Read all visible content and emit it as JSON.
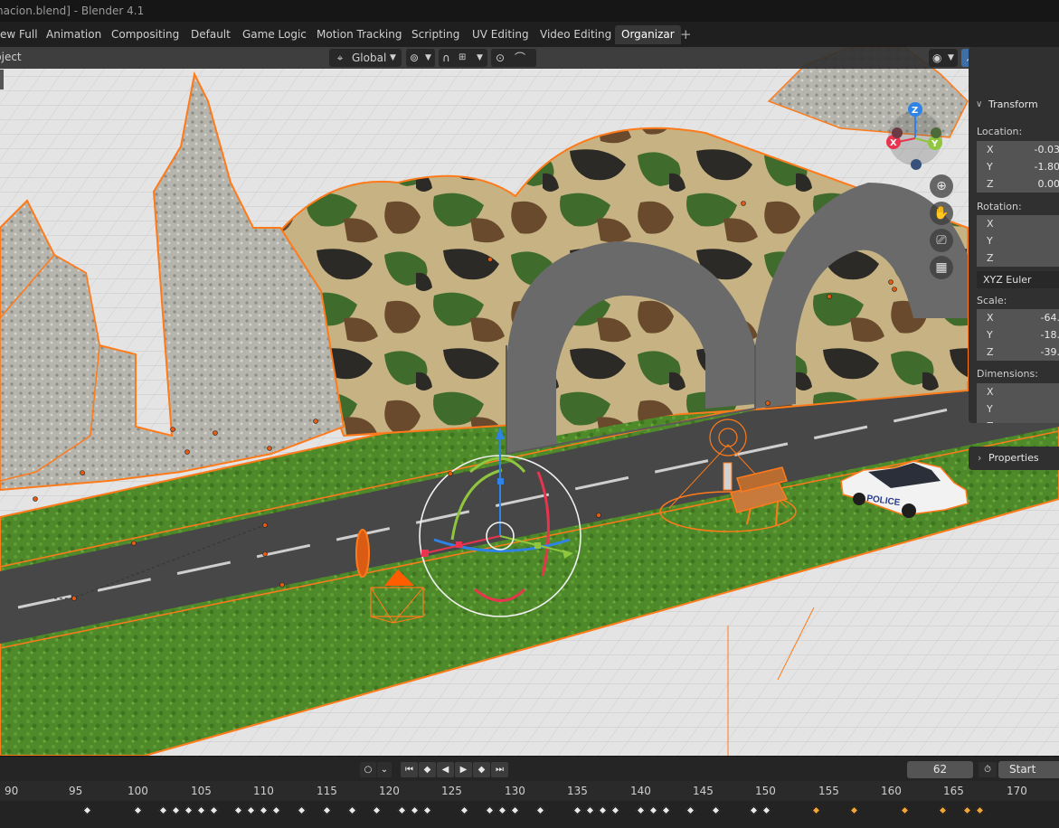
{
  "titlebar": {
    "title": "nacion.blend] - Blender 4.1"
  },
  "workspace_tabs": [
    {
      "label": "ew Full"
    },
    {
      "label": "Animation"
    },
    {
      "label": "Compositing"
    },
    {
      "label": "Default"
    },
    {
      "label": "Game Logic"
    },
    {
      "label": "Motion Tracking"
    },
    {
      "label": "Scripting"
    },
    {
      "label": "UV Editing"
    },
    {
      "label": "Video Editing"
    },
    {
      "label": "Organizar",
      "active": true
    }
  ],
  "tab_add": "+",
  "viewport_header": {
    "mode": "bject",
    "orientation": "Global"
  },
  "gizmo": {
    "x": "X",
    "y": "Y",
    "z": "Z"
  },
  "transform_panel": {
    "title": "Transform",
    "location_label": "Location:",
    "location": [
      {
        "axis": "X",
        "value": "-0.03"
      },
      {
        "axis": "Y",
        "value": "-1.80"
      },
      {
        "axis": "Z",
        "value": "0.00"
      }
    ],
    "rotation_label": "Rotation:",
    "rotation": [
      {
        "axis": "X",
        "value": ""
      },
      {
        "axis": "Y",
        "value": ""
      },
      {
        "axis": "Z",
        "value": ""
      }
    ],
    "rotation_mode": "XYZ Euler",
    "scale_label": "Scale:",
    "scale": [
      {
        "axis": "X",
        "value": "-64."
      },
      {
        "axis": "Y",
        "value": "-18."
      },
      {
        "axis": "Z",
        "value": "-39."
      }
    ],
    "dimensions_label": "Dimensions:",
    "dimensions": [
      {
        "axis": "X",
        "value": ""
      },
      {
        "axis": "Y",
        "value": ""
      },
      {
        "axis": "Z",
        "value": ""
      }
    ]
  },
  "properties_panel": {
    "title": "Properties"
  },
  "scene": {
    "police_text": "POLICE"
  },
  "timeline": {
    "current_frame": "62",
    "start_label": "Start",
    "ruler": [
      "90",
      "95",
      "100",
      "105",
      "110",
      "115",
      "120",
      "125",
      "130",
      "135",
      "140",
      "145",
      "150",
      "155",
      "160",
      "165",
      "170"
    ]
  },
  "colors": {
    "accent_blue": "#3d6ea6",
    "selection_orange": "#ff7a1a",
    "keyframe_selected": "#f0a53a",
    "axis_x": "#e8344e",
    "axis_y": "#8fc63e",
    "axis_z": "#2f83e6"
  }
}
